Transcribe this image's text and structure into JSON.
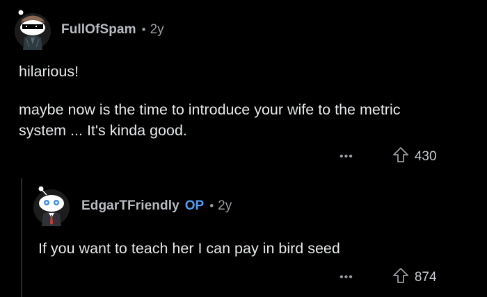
{
  "comments": [
    {
      "author": "FullOfSpam",
      "separator": "•",
      "age": "2y",
      "paragraphs": [
        "hilarious!",
        "maybe now is the time to introduce your wife to the metric system ... It's kinda good."
      ],
      "more_label": "•••",
      "upvotes": "430",
      "avatar_icon": "snoo-avatar-sunglasses-icon"
    },
    {
      "author": "EdgarTFriendly",
      "op_badge": "OP",
      "separator": "•",
      "age": "2y",
      "paragraphs": [
        "If you want to teach her I can pay in bird seed"
      ],
      "more_label": "•••",
      "upvotes": "874",
      "avatar_icon": "snoo-avatar-suit-icon"
    }
  ],
  "colors": {
    "background": "#000000",
    "op_badge": "#4f9df5",
    "text": "#e6e8ea",
    "meta": "#9a9ea2"
  }
}
